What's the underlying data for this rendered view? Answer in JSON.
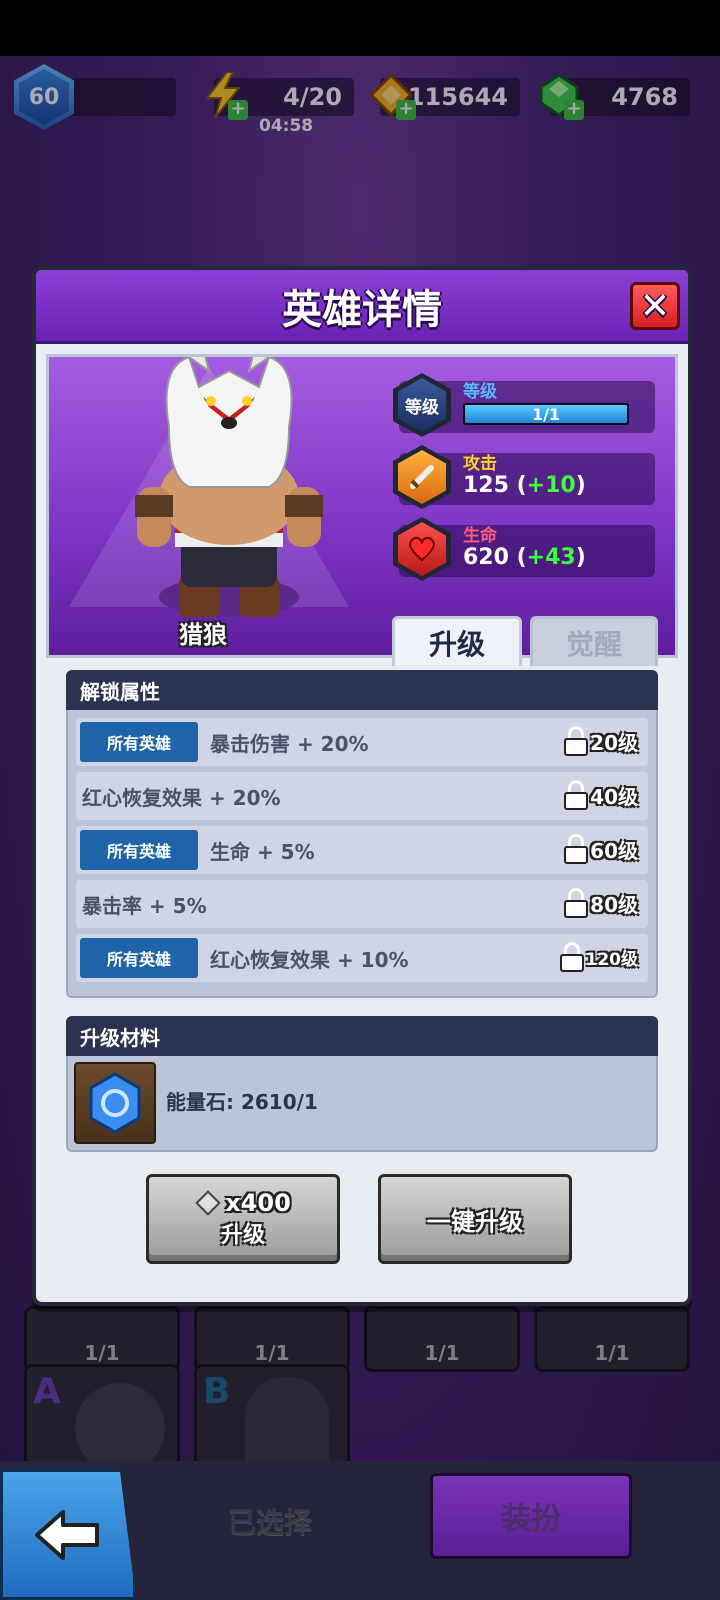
{
  "topbar": {
    "player_level": "60",
    "energy": "4/20",
    "energy_timer": "04:58",
    "gold": "115644",
    "gems": "4768",
    "plus_symbol": "+"
  },
  "modal": {
    "title": "英雄详情",
    "close_symbol": "✕",
    "hero": {
      "name": "猎狼",
      "level_label": "等级",
      "level_badge": "等级",
      "level_value": "1/1",
      "level_progress": 1.0,
      "attack_label": "攻击",
      "attack_value": "125",
      "attack_bonus": "+10",
      "hp_label": "生命",
      "hp_value": "620",
      "hp_bonus": "+43"
    },
    "tabs": {
      "upgrade": "升级",
      "awaken": "觉醒"
    },
    "unlock_section": {
      "title": "解锁属性",
      "rows": [
        {
          "tag": "所有英雄",
          "text": "暴击伤害 + 20%",
          "level": "20级"
        },
        {
          "tag": "",
          "text": "红心恢复效果 + 20%",
          "level": "40级"
        },
        {
          "tag": "所有英雄",
          "text": "生命 + 5%",
          "level": "60级"
        },
        {
          "tag": "",
          "text": "暴击率 + 5%",
          "level": "80级"
        },
        {
          "tag": "所有英雄",
          "text": "红心恢复效果 + 10%",
          "level": "120级"
        }
      ]
    },
    "material_section": {
      "title": "升级材料",
      "item_text": "能量石: 2610/1"
    },
    "buttons": {
      "upgrade_cost": "x400",
      "upgrade_label": "升级",
      "one_click_upgrade": "一键升级"
    }
  },
  "background_cards": {
    "levels": [
      "1/1",
      "1/1",
      "1/1",
      "1/1"
    ],
    "grades": [
      "A",
      "B"
    ]
  },
  "bottombar": {
    "selected_label": "已选择",
    "equip_label": "装扮"
  },
  "colors": {
    "header_purple": "#7a2ec6",
    "bonus_green": "#3dff3d",
    "tag_blue": "#1f64a8",
    "section_navy": "#2b3350"
  }
}
